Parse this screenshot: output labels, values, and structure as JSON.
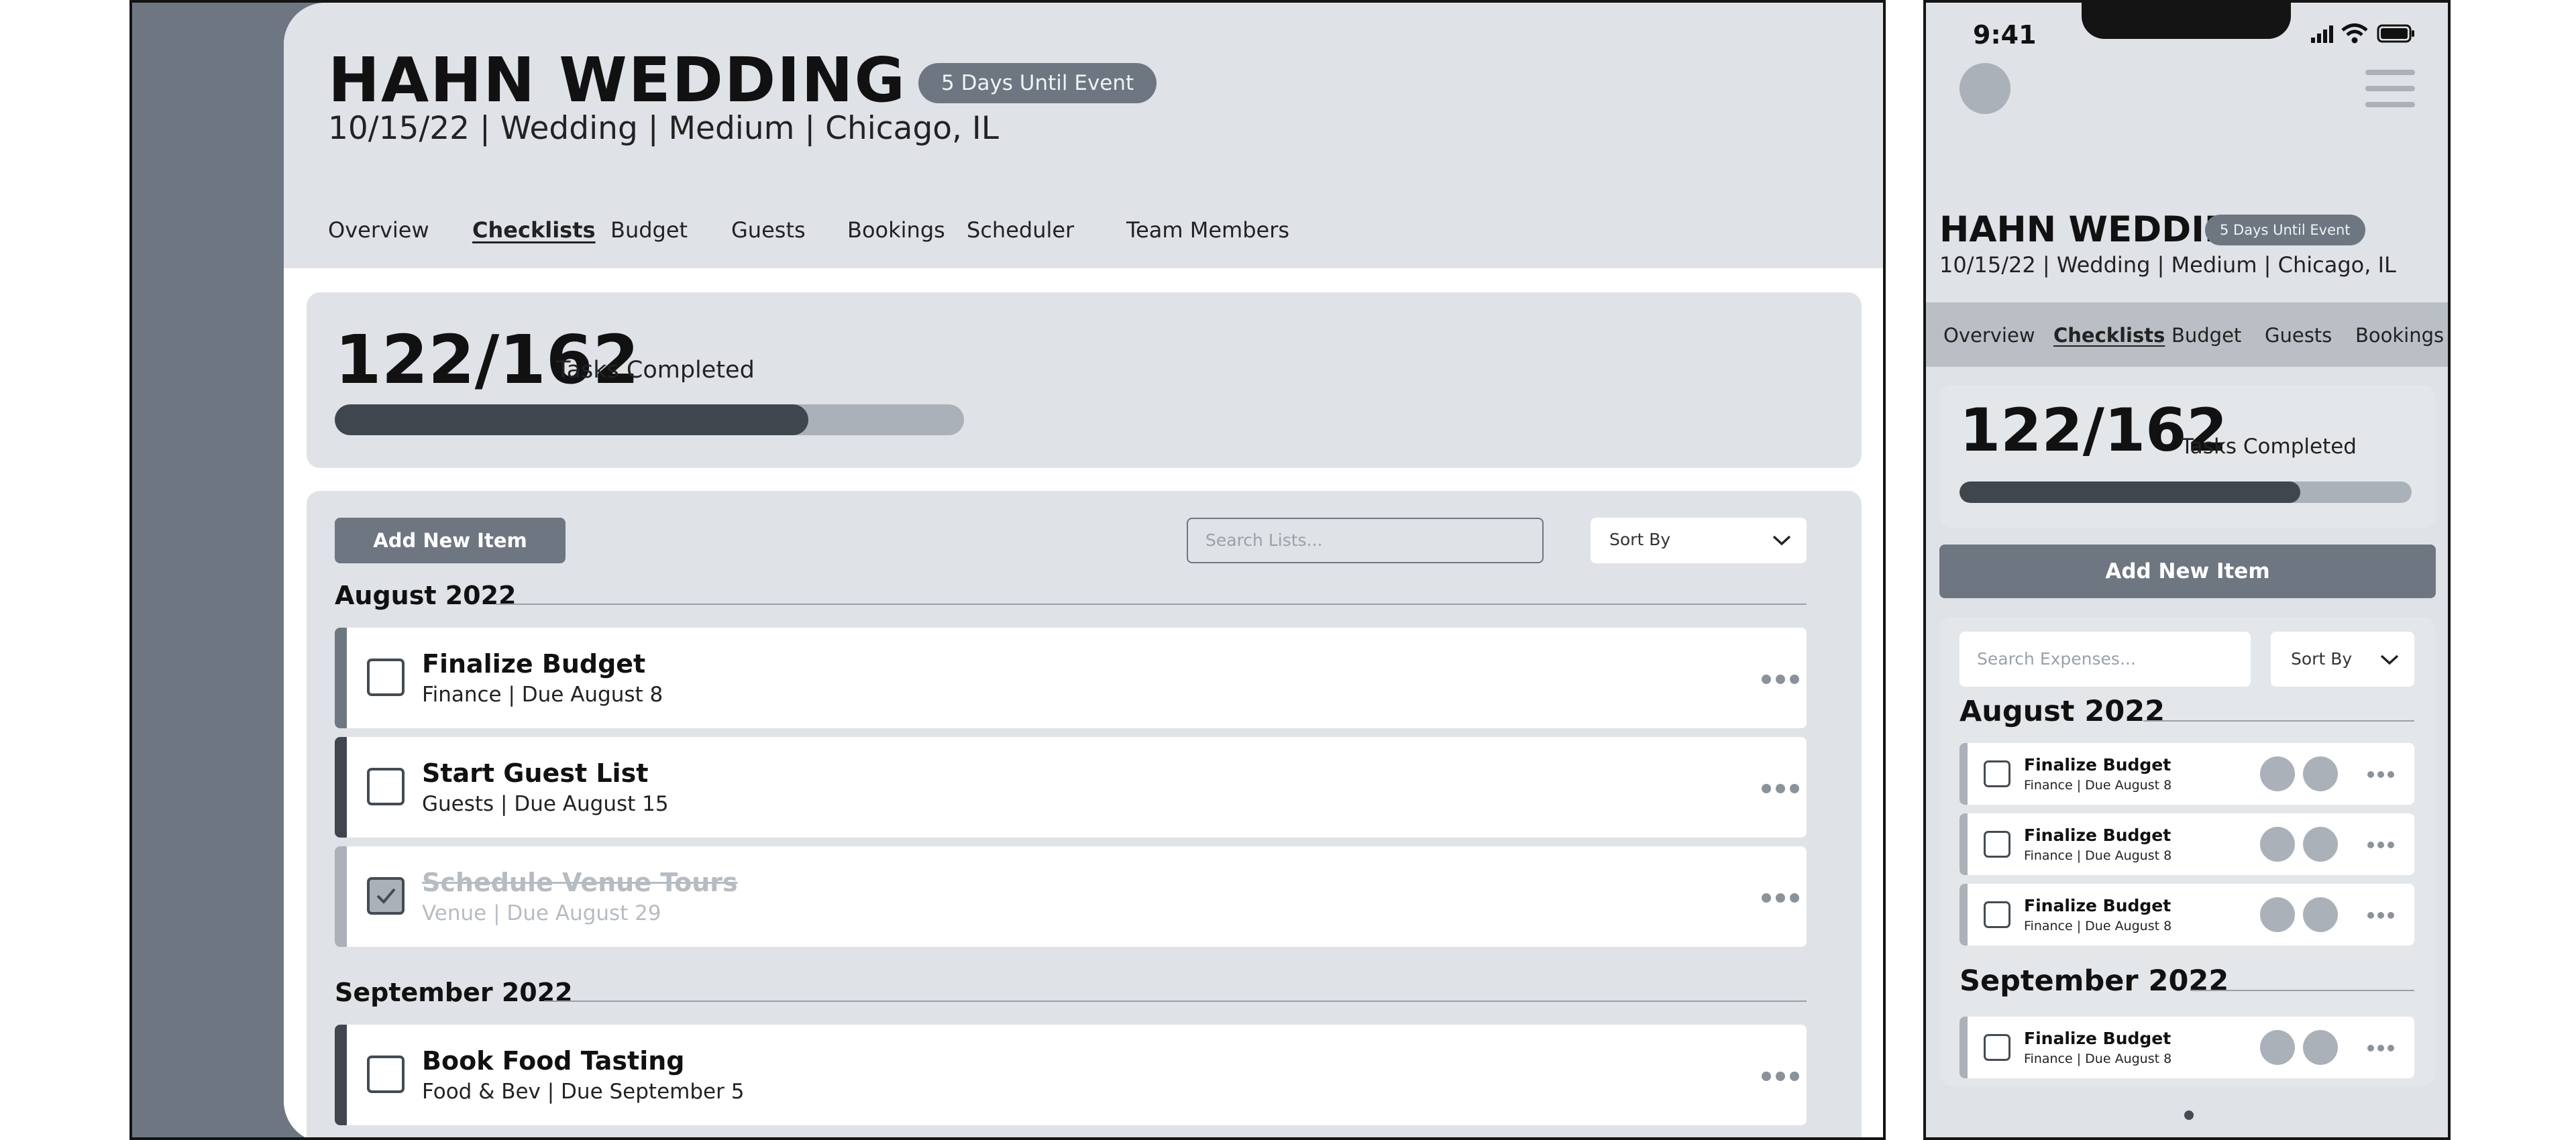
{
  "event": {
    "title": "HAHN WEDDING",
    "countdown_badge": "5 Days Until Event",
    "subtitle": "10/15/22 | Wedding | Medium | Chicago, IL"
  },
  "desktop": {
    "tabs": [
      "Overview",
      "Checklists",
      "Budget",
      "Guests",
      "Bookings",
      "Scheduler",
      "Team Members"
    ],
    "active_tab": "Checklists",
    "progress": {
      "count": "122/162",
      "label": "Tasks Completed",
      "completed": 122,
      "total": 162
    },
    "add_button": "Add New Item",
    "search_placeholder": "Search Lists...",
    "sort_label": "Sort By",
    "groups": [
      {
        "month": "August 2022",
        "items": [
          {
            "title": "Finalize Budget",
            "meta": "Finance | Due August 8",
            "checked": false
          },
          {
            "title": "Start Guest List",
            "meta": "Guests | Due August 15",
            "checked": false
          },
          {
            "title": "Schedule Venue Tours",
            "meta": "Venue | Due August 29",
            "checked": true
          }
        ]
      },
      {
        "month": "September 2022",
        "items": [
          {
            "title": "Book Food Tasting",
            "meta": "Food & Bev | Due September 5",
            "checked": false
          }
        ]
      }
    ]
  },
  "mobile": {
    "status_time": "9:41",
    "tabs": [
      "Overview",
      "Checklists",
      "Budget",
      "Guests",
      "Bookings"
    ],
    "active_tab": "Checklists",
    "progress": {
      "count": "122/162",
      "label": "Tasks Completed"
    },
    "add_button": "Add New Item",
    "search_placeholder": "Search Expenses...",
    "sort_label": "Sort By",
    "groups": [
      {
        "month": "August 2022",
        "items": [
          {
            "title": "Finalize Budget",
            "meta": "Finance | Due August 8"
          },
          {
            "title": "Finalize Budget",
            "meta": "Finance | Due August 8"
          },
          {
            "title": "Finalize Budget",
            "meta": "Finance | Due August 8"
          }
        ]
      },
      {
        "month": "September 2022",
        "items": [
          {
            "title": "Finalize Budget",
            "meta": "Finance | Due August 8"
          }
        ]
      }
    ]
  },
  "colors": {
    "panel_bg": "#dfe2e6",
    "sidebar": "#6e7781",
    "progress_fill": "#3f464d",
    "progress_track": "#aab1b8",
    "row_bar_light": "#6e7781",
    "row_bar_dark": "#3f464d"
  }
}
